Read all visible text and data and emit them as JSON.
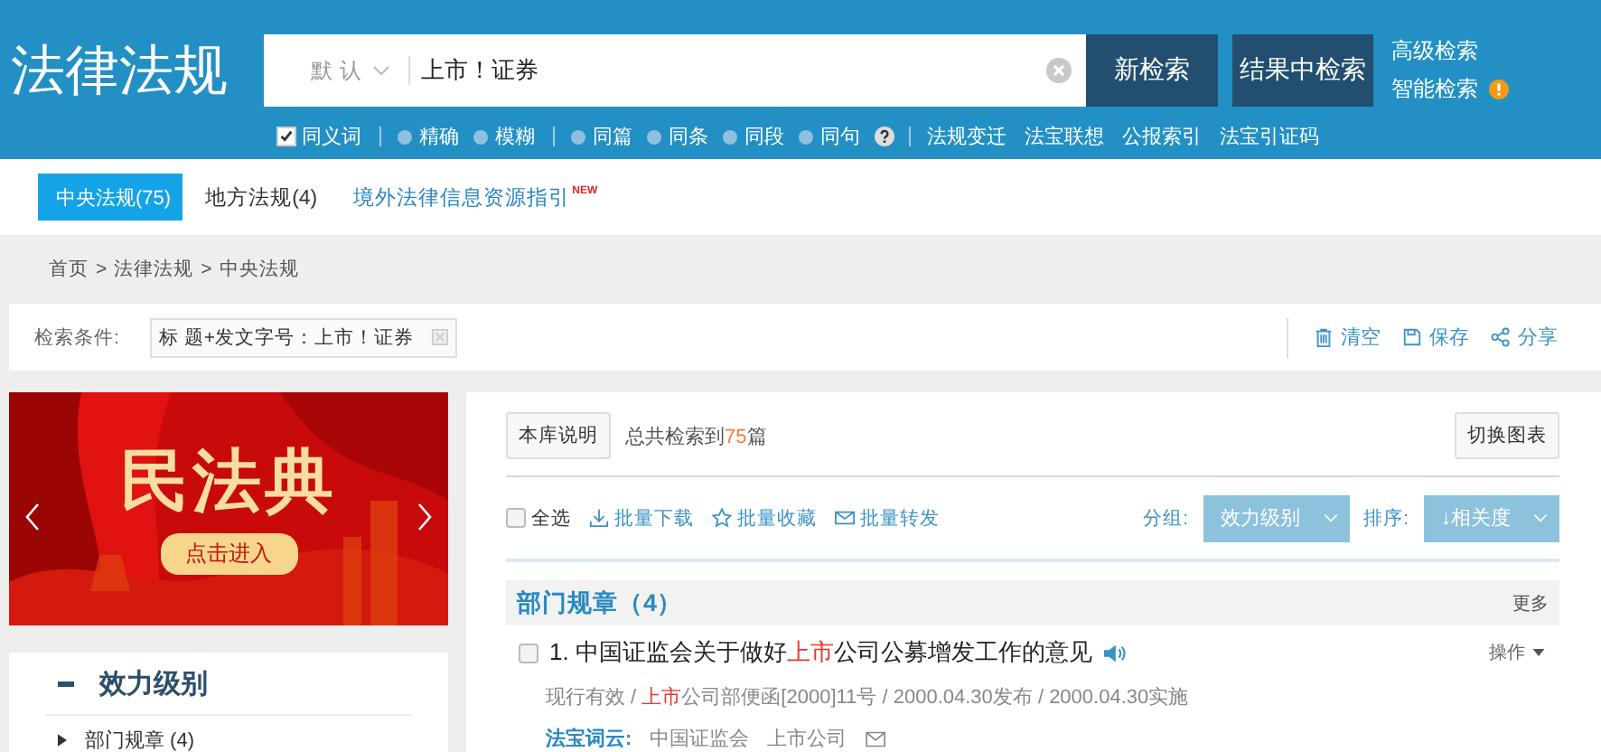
{
  "header": {
    "logo": "法律法规",
    "search": {
      "scope": "默认",
      "value": "上市！证券"
    },
    "buttons": [
      "新检索",
      "结果中检索"
    ],
    "links": [
      {
        "label": "高级检索",
        "alert": false
      },
      {
        "label": "智能检索",
        "alert": true
      }
    ],
    "options": [
      {
        "label": "同义词",
        "kind": "checkbox",
        "checked": true
      },
      {
        "label": "精确",
        "kind": "radio",
        "selected": false
      },
      {
        "label": "模糊",
        "kind": "radio",
        "selected": false
      },
      {
        "label": "同篇",
        "kind": "radio",
        "selected": false
      },
      {
        "label": "同条",
        "kind": "radio",
        "selected": false
      },
      {
        "label": "同段",
        "kind": "radio",
        "selected": false
      },
      {
        "label": "同句",
        "kind": "radio",
        "selected": false
      }
    ],
    "tools": [
      "法规变迁",
      "法宝联想",
      "公报索引",
      "法宝引证码"
    ]
  },
  "tabs": [
    {
      "label": "中央法规(75)",
      "kind": "tab",
      "selected": true
    },
    {
      "label": "地方法规(4)",
      "kind": "tab",
      "selected": false
    },
    {
      "label": "境外法律信息资源指引",
      "kind": "link",
      "selected": false,
      "badge": "NEW"
    }
  ],
  "breadcrumb": {
    "items": [
      "首页",
      "法律法规",
      "中央法规"
    ],
    "separator": ">"
  },
  "condition": {
    "label": "检索条件:",
    "value": "标 题+发文字号：上市！证券",
    "actions": [
      "清空",
      "保存",
      "分享"
    ]
  },
  "banner": {
    "title": "民法典",
    "button": "点击进入"
  },
  "facet": {
    "title": "效力级别",
    "expanded": true,
    "items": [
      "部门规章 (4)"
    ]
  },
  "results": {
    "info_button": "本库说明",
    "total": {
      "prefix": "总共检索到",
      "count": "75",
      "suffix": "篇"
    },
    "chart_button": "切换图表",
    "select_all": {
      "label": "全选",
      "checked": false
    },
    "batch": [
      "批量下载",
      "批量收藏",
      "批量转发"
    ],
    "group_label": "分组:",
    "group_value": "效力级别",
    "sort_label": "排序:",
    "sort_value": "↓相关度",
    "groups": [
      {
        "title": "部门规章（4）",
        "more": "更多",
        "items": [
          {
            "checked": false,
            "title": [
              {
                "text": "1. 中国证监会关于做好",
                "highlight": false
              },
              {
                "text": "上市",
                "highlight": true
              },
              {
                "text": "公司公募增发工作的意见",
                "highlight": false
              }
            ],
            "action": "操作",
            "meta": [
              {
                "text": "现行有效 / ",
                "highlight": false
              },
              {
                "text": "上市",
                "highlight": true
              },
              {
                "text": "公司部便函[2000]11号 / 2000.04.30发布 / 2000.04.30实施",
                "highlight": false
              }
            ],
            "tags_label": "法宝词云:",
            "tags": [
              "中国证监会",
              "上市公司"
            ]
          }
        ]
      }
    ]
  }
}
